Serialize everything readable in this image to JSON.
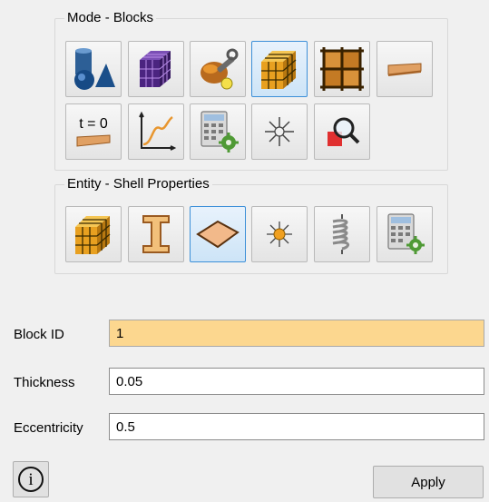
{
  "mode_group": {
    "title": "Mode - Blocks",
    "buttons": [
      {
        "icon": "geometry-shapes-icon",
        "active": false
      },
      {
        "icon": "mesh-cube-icon",
        "active": false
      },
      {
        "icon": "node-tools-icon",
        "active": false
      },
      {
        "icon": "blocks-cube-icon",
        "active": true
      },
      {
        "icon": "element-grid-icon",
        "active": false
      },
      {
        "icon": "shell-plate-icon",
        "active": false
      },
      {
        "icon": "initial-condition-icon",
        "active": false,
        "text": "t = 0"
      },
      {
        "icon": "curve-graph-icon",
        "active": false
      },
      {
        "icon": "calculator-settings-icon",
        "active": false
      },
      {
        "icon": "point-sparkle-icon",
        "active": false
      },
      {
        "icon": "magnify-search-icon",
        "active": false
      }
    ]
  },
  "entity_group": {
    "title": "Entity - Shell Properties",
    "buttons": [
      {
        "icon": "block-cube-icon",
        "active": false
      },
      {
        "icon": "beam-i-section-icon",
        "active": false
      },
      {
        "icon": "shell-diamond-icon",
        "active": true
      },
      {
        "icon": "point-star-icon",
        "active": false
      },
      {
        "icon": "spring-coil-icon",
        "active": false
      },
      {
        "icon": "calculator-settings-icon",
        "active": false
      }
    ]
  },
  "form": {
    "block_id_label": "Block ID",
    "block_id_value": "1",
    "thickness_label": "Thickness",
    "thickness_value": "0.05",
    "eccentricity_label": "Eccentricity",
    "eccentricity_value": "0.5"
  },
  "footer": {
    "info_glyph": "i",
    "apply_label": "Apply"
  },
  "colors": {
    "active_border": "#3c8fd8",
    "highlight_field": "#fcd78f",
    "orange": "#e8962f"
  }
}
